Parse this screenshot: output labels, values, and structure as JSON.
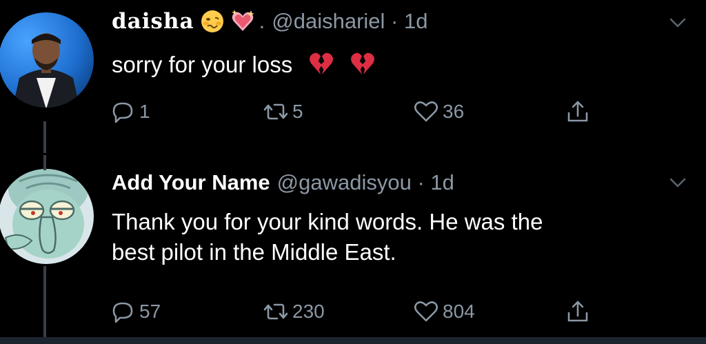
{
  "tweets": [
    {
      "display_name": "daisha",
      "name_emojis": [
        "woozy-face-emoji",
        "sparkling-heart-emoji"
      ],
      "name_suffix": ".",
      "handle_time": "@daishariel · 1d",
      "text": "sorry for your loss",
      "text_emojis": [
        "broken-heart-emoji",
        "broken-heart-emoji"
      ],
      "replies": "1",
      "retweets": "5",
      "likes": "36"
    },
    {
      "display_name": "Add Your Name",
      "handle_time": "@gawadisyou · 1d",
      "text_line1": "Thank you for your kind words. He was the",
      "text_line2": "best pilot in the Middle East.",
      "replies": "57",
      "retweets": "230",
      "likes": "804"
    }
  ],
  "colors": {
    "background": "#000000",
    "text": "#ffffff",
    "secondary": "#8b98a5",
    "thread_line": "#3a3f45"
  },
  "icons": [
    "reply-icon",
    "retweet-icon",
    "like-icon",
    "share-icon",
    "chevron-down-icon"
  ]
}
